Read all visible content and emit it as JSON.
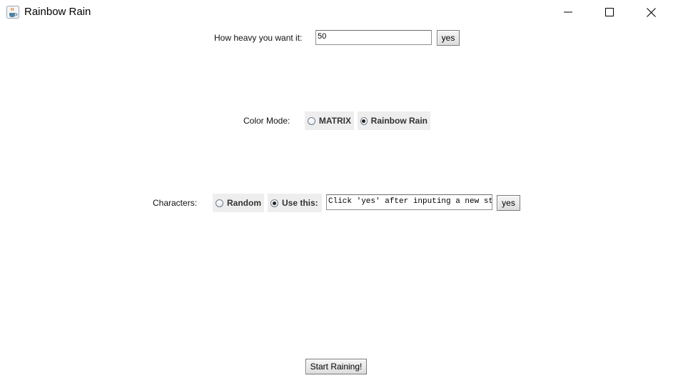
{
  "window": {
    "title": "Rainbow Rain",
    "icon": "java-cup-icon",
    "controls": [
      "minimize-icon",
      "maximize-icon",
      "close-icon"
    ]
  },
  "heaviness": {
    "label": "How heavy you want it:",
    "value": "50",
    "confirm_label": "yes"
  },
  "color_mode": {
    "label": "Color Mode:",
    "options": [
      "MATRIX",
      "Rainbow Rain"
    ],
    "selected": "Rainbow Rain"
  },
  "characters": {
    "label": "Characters:",
    "options": [
      "Random",
      "Use this:"
    ],
    "selected": "Use this:",
    "custom_value": "Click 'yes' after inputing a new strin",
    "confirm_label": "yes"
  },
  "start_button": {
    "label": "Start Raining!"
  }
}
